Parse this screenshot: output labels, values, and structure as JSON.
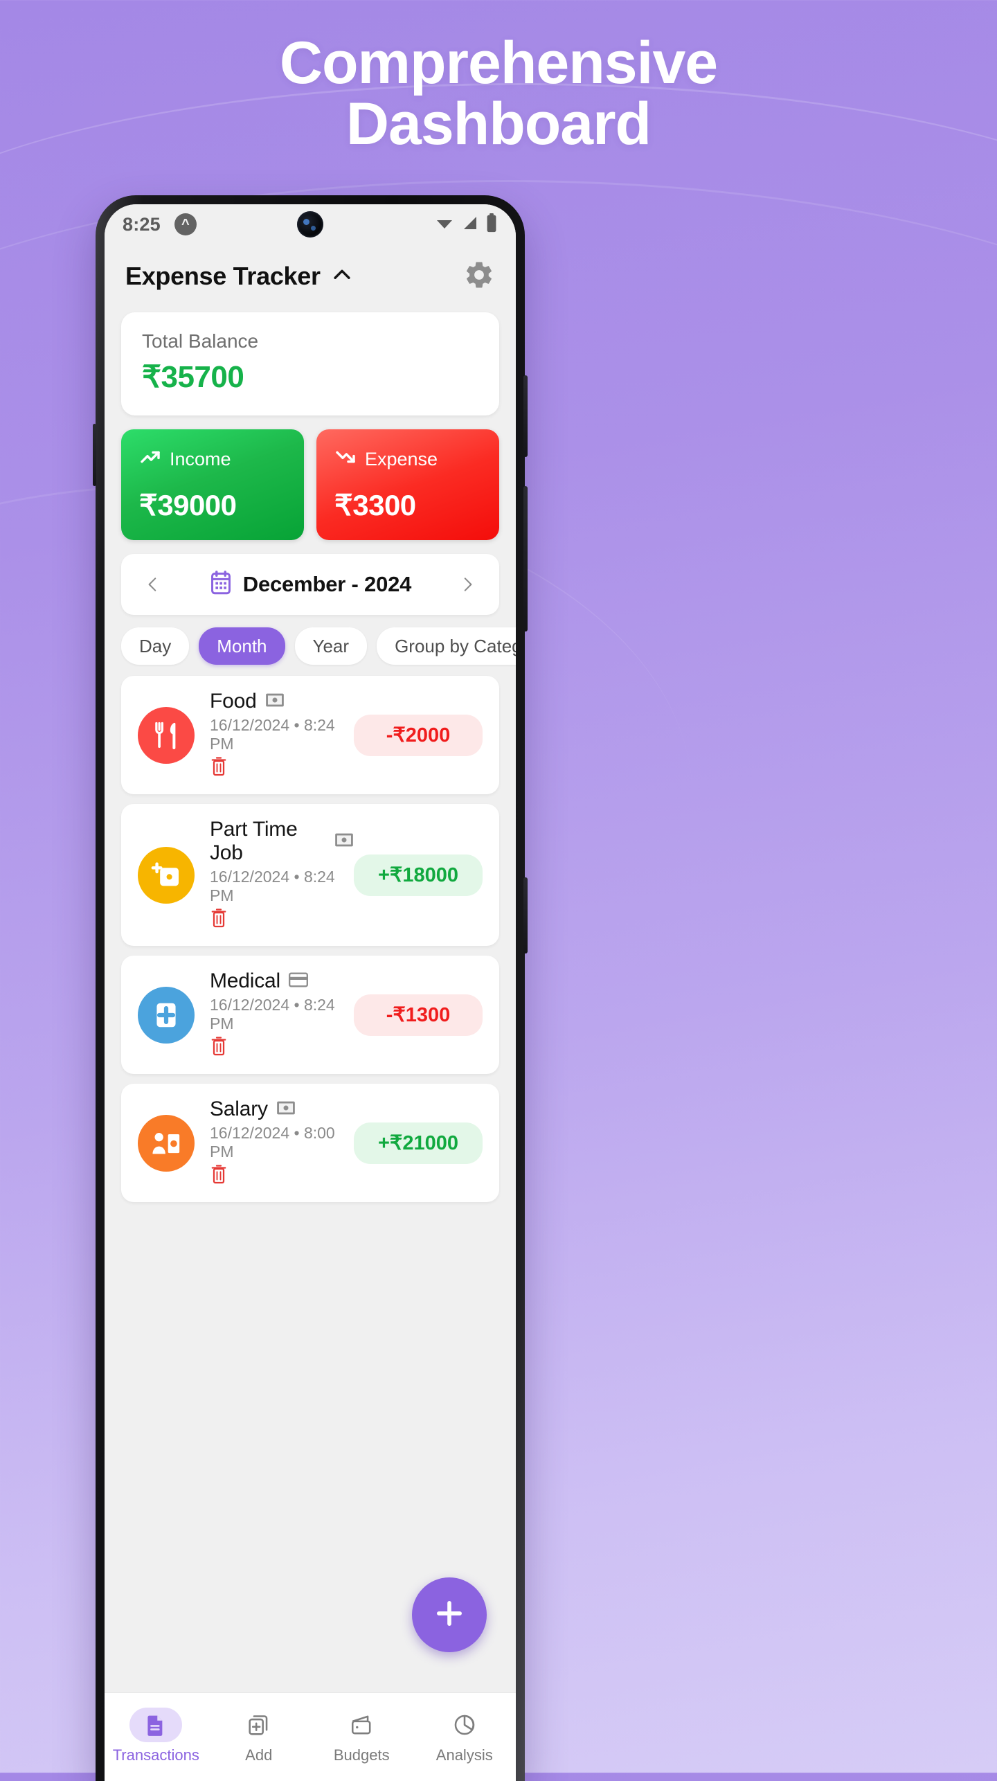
{
  "headline": {
    "line1": "Comprehensive",
    "line2": "Dashboard"
  },
  "statusbar": {
    "time": "8:25",
    "app_badge": "app-indicator",
    "icons": [
      "wifi-icon",
      "cellular-signal-icon",
      "battery-icon"
    ]
  },
  "appbar": {
    "title": "Expense Tracker",
    "expand_icon": "chevron-up-icon",
    "settings_icon": "gear-icon"
  },
  "balance": {
    "label": "Total Balance",
    "amount": "₹35700",
    "color": "#16b24a"
  },
  "summary": [
    {
      "label": "Income",
      "amount": "₹39000",
      "icon": "trending-up-icon",
      "color": "#1db84a"
    },
    {
      "label": "Expense",
      "amount": "₹3300",
      "icon": "trending-down-icon",
      "color": "#fb2b23"
    }
  ],
  "period": {
    "prev_icon": "chevron-left-icon",
    "next_icon": "chevron-right-icon",
    "calendar_icon": "calendar-icon",
    "label": "December - 2024"
  },
  "filters": [
    {
      "label": "Day",
      "active": false
    },
    {
      "label": "Month",
      "active": true
    },
    {
      "label": "Year",
      "active": false
    },
    {
      "label": "Group by Category",
      "active": false
    }
  ],
  "transactions": [
    {
      "title": "Food",
      "date": "16/12/2024 • 8:24 PM",
      "amount": "-₹2000",
      "kind": "expense",
      "icon": "food-icon",
      "icon_color": "#fb4a45",
      "method_icon": "cash-icon",
      "delete_icon": "trash-icon"
    },
    {
      "title": "Part Time Job",
      "date": "16/12/2024 • 8:24 PM",
      "amount": "+₹18000",
      "kind": "income",
      "icon": "wallet-plus-icon",
      "icon_color": "#f7b500",
      "method_icon": "cash-icon",
      "delete_icon": "trash-icon"
    },
    {
      "title": "Medical",
      "date": "16/12/2024 • 8:24 PM",
      "amount": "-₹1300",
      "kind": "expense",
      "icon": "medical-cross-icon",
      "icon_color": "#4ba3dd",
      "method_icon": "card-icon",
      "delete_icon": "trash-icon"
    },
    {
      "title": "Salary",
      "date": "16/12/2024 • 8:00 PM",
      "amount": "+₹21000",
      "kind": "income",
      "icon": "salary-person-money-icon",
      "icon_color": "#f97b28",
      "method_icon": "cash-icon",
      "delete_icon": "trash-icon"
    }
  ],
  "fab": {
    "icon": "plus-icon",
    "color": "#8b63e0"
  },
  "bottom_nav": [
    {
      "label": "Transactions",
      "icon": "document-icon",
      "active": true
    },
    {
      "label": "Add",
      "icon": "add-card-icon",
      "active": false
    },
    {
      "label": "Budgets",
      "icon": "wallet-icon",
      "active": false
    },
    {
      "label": "Analysis",
      "icon": "pie-chart-icon",
      "active": false
    }
  ]
}
